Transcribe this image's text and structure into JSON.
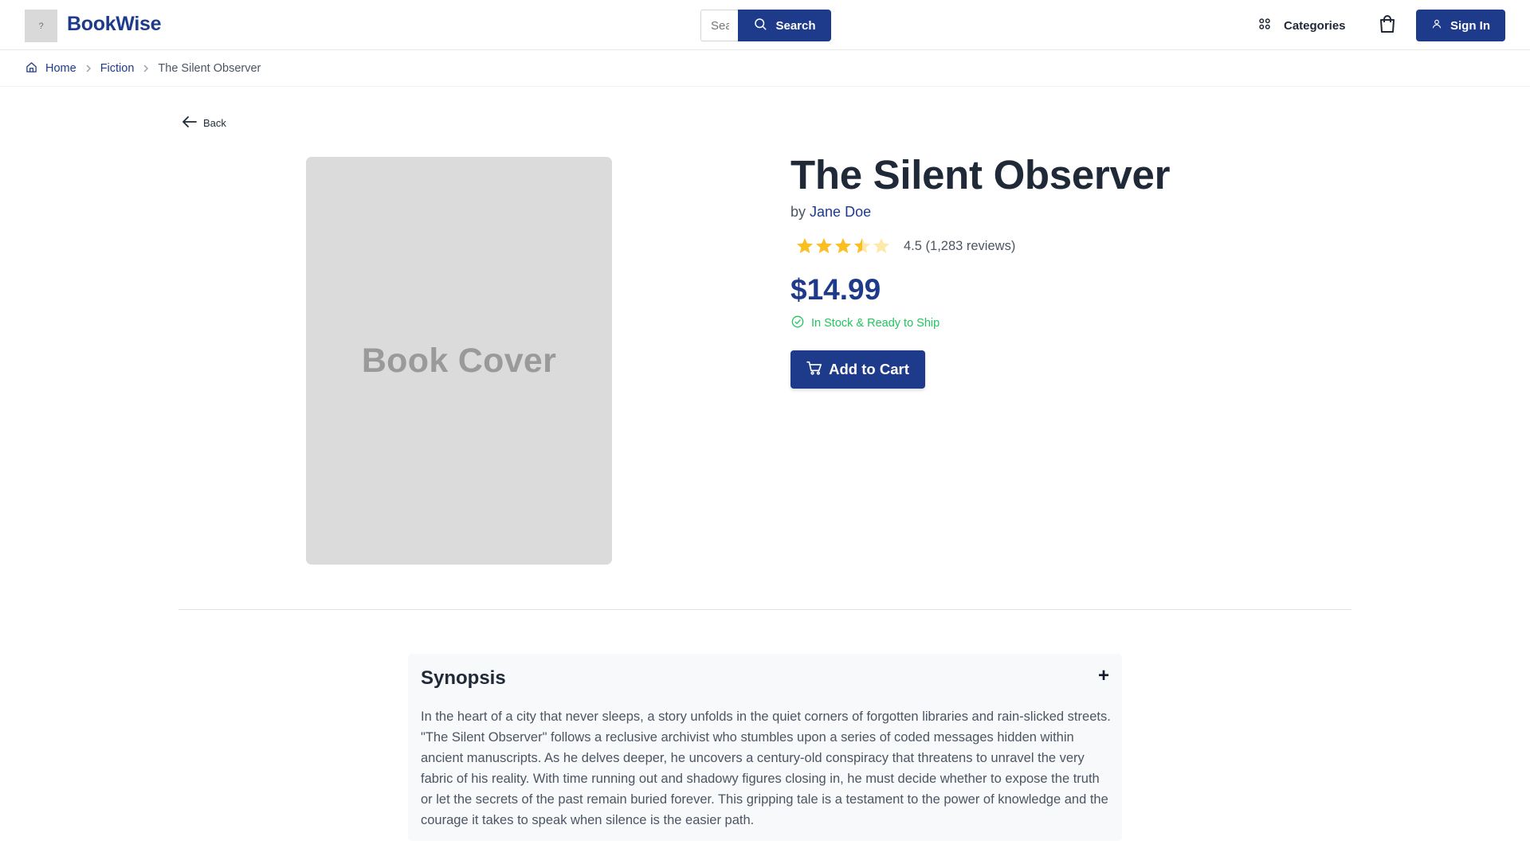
{
  "header": {
    "logo_glyph": "?",
    "brand": "BookWise",
    "search": {
      "placeholder": "Search",
      "button_label": "Search"
    },
    "categories_label": "Categories",
    "signin_label": "Sign In",
    "accent_color": "#1e3a8a"
  },
  "breadcrumb": {
    "items": [
      {
        "label": "Home",
        "icon": "home-icon"
      },
      {
        "label": "Fiction"
      },
      {
        "label": "The Silent Observer"
      }
    ]
  },
  "back_label": "Back",
  "cover": {
    "placeholder_text": "Book Cover"
  },
  "book": {
    "title": "The Silent Observer",
    "by_prefix": "by",
    "author": "Jane Doe",
    "rating": 4.5,
    "rating_text": "4.5 (1,283 reviews)",
    "price": "$14.99",
    "stock_text": "In Stock & Ready to Ship",
    "stock_color": "#22c55e",
    "add_to_cart_label": "Add to Cart"
  },
  "synopsis": {
    "heading": "Synopsis",
    "toggle": "+",
    "body": "In the heart of a city that never sleeps, a story unfolds in the quiet corners of forgotten libraries and rain-slicked streets. \"The Silent Observer\" follows a reclusive archivist who stumbles upon a series of coded messages hidden within ancient manuscripts. As he delves deeper, he uncovers a century-old conspiracy that threatens to unravel the very fabric of his reality. With time running out and shadowy figures closing in, he must decide whether to expose the truth or let the secrets of the past remain buried forever. This gripping tale is a testament to the power of knowledge and the courage it takes to speak when silence is the easier path."
  }
}
